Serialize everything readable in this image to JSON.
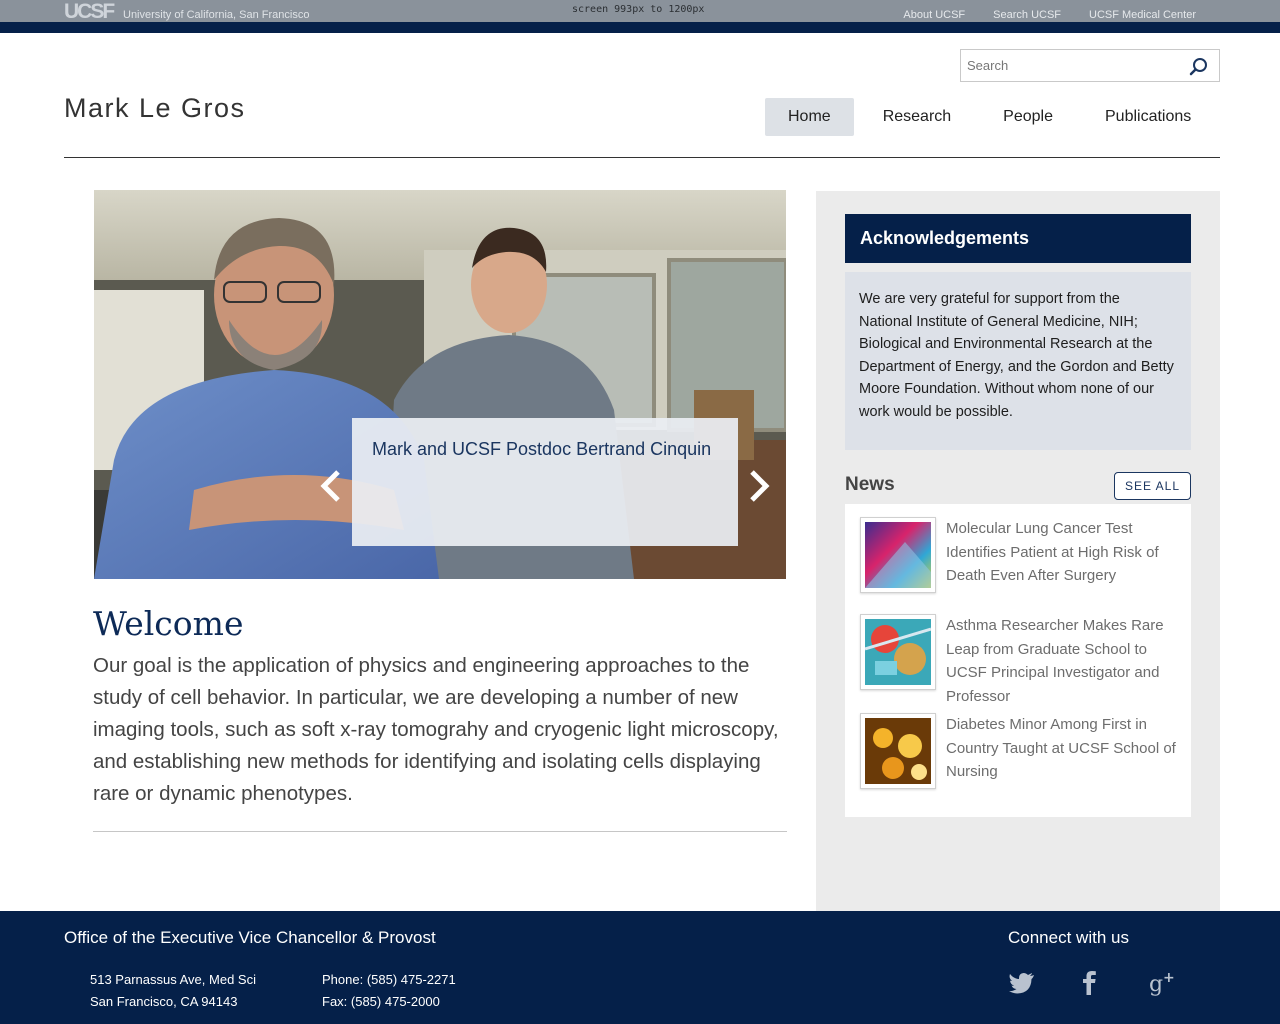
{
  "topbar": {
    "logo": "UCSF",
    "university": "University of California, San Francisco",
    "screen_note": "screen 993px to 1200px",
    "links": [
      "About UCSF",
      "Search UCSF",
      "UCSF Medical Center"
    ]
  },
  "search": {
    "placeholder": "Search"
  },
  "site": {
    "title": "Mark Le Gros"
  },
  "nav": {
    "items": [
      "Home",
      "Research",
      "People",
      "Publications"
    ],
    "active": "Home"
  },
  "hero": {
    "caption": "Mark and UCSF Postdoc Bertrand Cinquin"
  },
  "welcome": {
    "title": "Welcome",
    "body": "Our goal is the application of physics and engineering approaches to the study of cell behavior.  In particular, we are developing a number of new imaging tools, such as soft x-ray tomograhy and cryogenic light microscopy, and establishing new methods for identifying and isolating cells displaying rare or dynamic phenotypes."
  },
  "acknowledgements": {
    "title": "Acknowledgements",
    "body": "We are very grateful for support from the National Institute of General Medicine, NIH;  Biological and Environmental Research at the Department of Energy, and the Gordon and Betty Moore Foundation. Without whom none of our work would be possible."
  },
  "news": {
    "title": "News",
    "see_all": "SEE ALL",
    "items": [
      {
        "title": "Molecular Lung Cancer Test Identifies Patient at High Risk of Death Even After Surgery"
      },
      {
        "title": "Asthma Researcher Makes Rare Leap from Graduate School to UCSF Principal Investigator and Professor"
      },
      {
        "title": "Diabetes Minor Among First in Country Taught at UCSF School of Nursing"
      }
    ]
  },
  "footer": {
    "office": "Office of the Executive Vice Chancellor & Provost",
    "address_line1": "513 Parnassus Ave, Med Sci",
    "address_line2": "San Francisco, CA 94143",
    "phone": "Phone: (585) 475-2271",
    "fax": "Fax: (585) 475-2000",
    "connect": "Connect with us",
    "social": [
      "twitter-icon",
      "facebook-icon",
      "google-plus-icon"
    ]
  },
  "colors": {
    "navy": "#052049",
    "topbar_gray": "#8a929b",
    "sidebar_gray": "#ebebeb",
    "ack_bg": "#dde1e8"
  }
}
